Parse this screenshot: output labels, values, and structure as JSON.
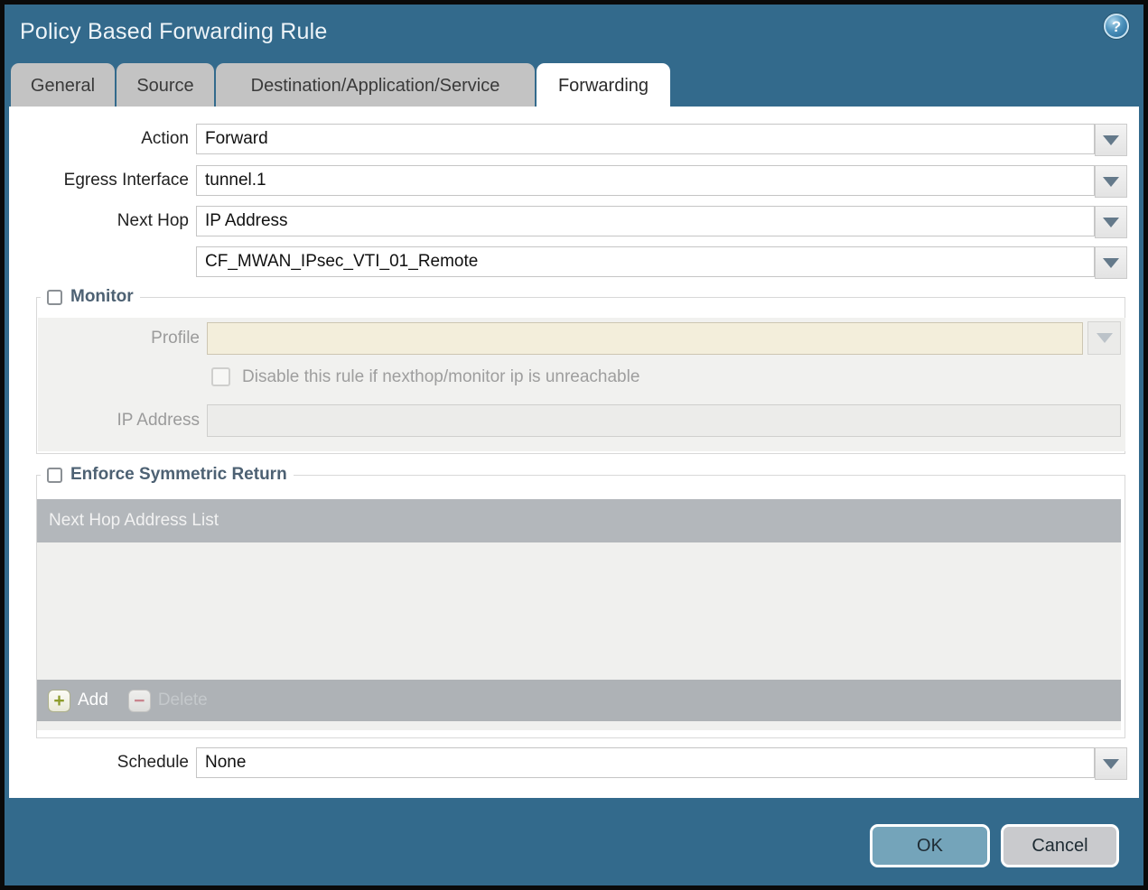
{
  "window": {
    "title": "Policy Based Forwarding Rule",
    "help_glyph": "?"
  },
  "tabs": [
    {
      "label": "General",
      "active": false
    },
    {
      "label": "Source",
      "active": false
    },
    {
      "label": "Destination/Application/Service",
      "active": false
    },
    {
      "label": "Forwarding",
      "active": true
    }
  ],
  "form": {
    "action_label": "Action",
    "action_value": "Forward",
    "egress_label": "Egress Interface",
    "egress_value": "tunnel.1",
    "next_hop_label": "Next Hop",
    "next_hop_value": "IP Address",
    "next_hop_address_value": "CF_MWAN_IPsec_VTI_01_Remote",
    "schedule_label": "Schedule",
    "schedule_value": "None"
  },
  "monitor": {
    "title": "Monitor",
    "checked": false,
    "profile_label": "Profile",
    "profile_value": "",
    "disable_label": "Disable this rule if nexthop/monitor ip is unreachable",
    "ip_label": "IP Address",
    "ip_value": ""
  },
  "symmetric_return": {
    "title": "Enforce Symmetric Return",
    "checked": false,
    "table_header": "Next Hop Address List",
    "add_glyph": "+",
    "add_label": "Add",
    "delete_glyph": "−",
    "delete_label": "Delete"
  },
  "footer": {
    "ok_label": "OK",
    "cancel_label": "Cancel"
  },
  "colors": {
    "frame": "#336a8c",
    "active_tab": "#ffffff",
    "inactive_tab": "#c3c3c3",
    "disabled_profile_field": "#f3eedb",
    "table_header": "#b3b7bb",
    "ok_button": "#74a4ba",
    "cancel_button": "#c9cacd"
  }
}
